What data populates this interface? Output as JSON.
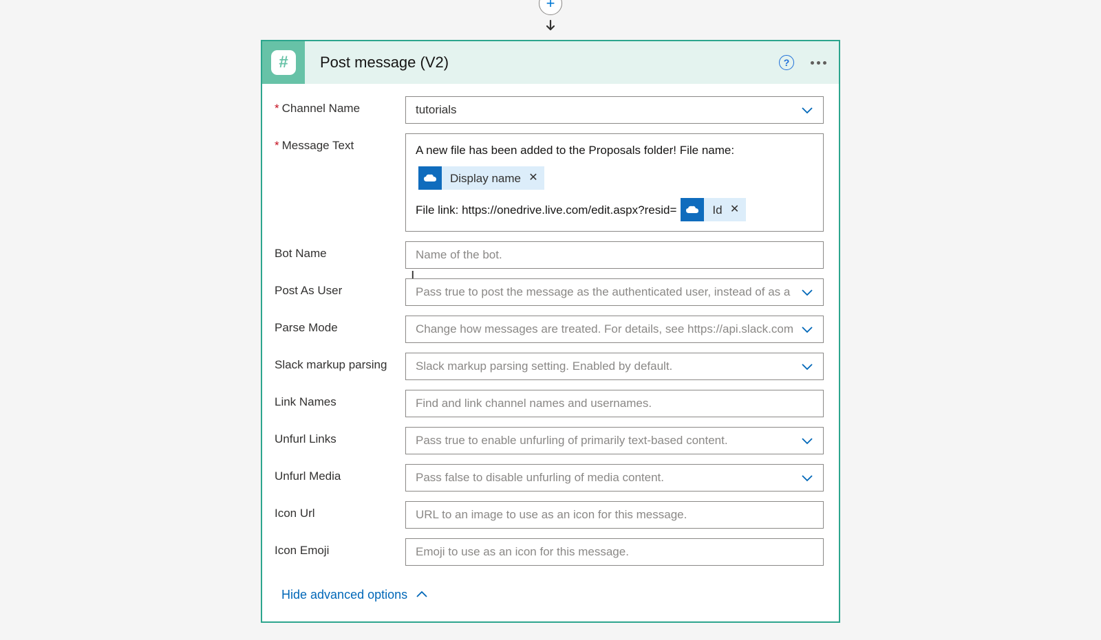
{
  "header": {
    "title": "Post message (V2)"
  },
  "fields": {
    "channel_name": {
      "label": "Channel Name",
      "value": "tutorials",
      "required": true
    },
    "message_text": {
      "label": "Message Text",
      "required": true,
      "line1_prefix": "A new file has been added to the Proposals folder!  File name:",
      "token1": "Display name",
      "line2_prefix": "File link: https://onedrive.live.com/edit.aspx?resid=",
      "token2": "Id"
    },
    "bot_name": {
      "label": "Bot Name",
      "placeholder": "Name of the bot."
    },
    "post_as_user": {
      "label": "Post As User",
      "placeholder": "Pass true to post the message as the authenticated user, instead of as a"
    },
    "parse_mode": {
      "label": "Parse Mode",
      "placeholder": "Change how messages are treated. For details, see https://api.slack.com"
    },
    "slack_markup": {
      "label": "Slack markup parsing",
      "placeholder": "Slack markup parsing setting. Enabled by default."
    },
    "link_names": {
      "label": "Link Names",
      "placeholder": "Find and link channel names and usernames."
    },
    "unfurl_links": {
      "label": "Unfurl Links",
      "placeholder": "Pass true to enable unfurling of primarily text-based content."
    },
    "unfurl_media": {
      "label": "Unfurl Media",
      "placeholder": "Pass false to disable unfurling of media content."
    },
    "icon_url": {
      "label": "Icon Url",
      "placeholder": "URL to an image to use as an icon for this message."
    },
    "icon_emoji": {
      "label": "Icon Emoji",
      "placeholder": "Emoji to use as an icon for this message."
    }
  },
  "footer": {
    "hide_advanced": "Hide advanced options"
  }
}
